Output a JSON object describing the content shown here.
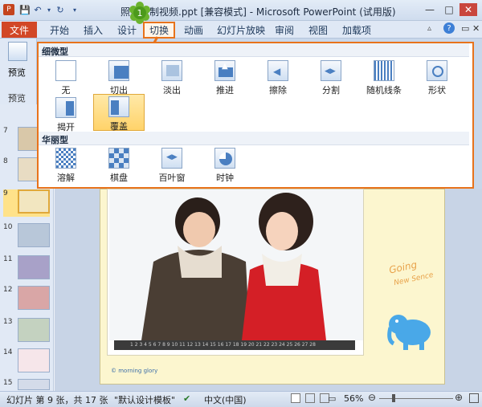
{
  "titlebar": {
    "title": "照片转制视频.ppt [兼容模式] - Microsoft PowerPoint (试用版)"
  },
  "tabs": {
    "file": "文件",
    "items": [
      "开始",
      "插入",
      "设计",
      "切换",
      "动画",
      "幻灯片放映",
      "审阅",
      "视图",
      "加载项"
    ]
  },
  "badge": "1",
  "left": {
    "preview": "预览",
    "preview_group": "预览"
  },
  "gallery": {
    "section1": "细微型",
    "section2": "华丽型",
    "subtle": [
      "无",
      "切出",
      "淡出",
      "推进",
      "擦除",
      "分割",
      "随机线条",
      "形状",
      "揭开",
      "覆盖"
    ],
    "exciting": [
      "溶解",
      "棋盘",
      "百叶窗",
      "时钟"
    ]
  },
  "thumbnails": [
    "7",
    "8",
    "9",
    "10",
    "11",
    "12",
    "13",
    "14",
    "15"
  ],
  "slide": {
    "caption": "© morning glory",
    "deco_text1": "Going",
    "deco_text2": "New Sence",
    "frame_nums": "1 2 3 4 5 6 7 8 9 10 11 12 13 14 15 16 17 18 19 20 21 22 23 24 25 26 27 28"
  },
  "status": {
    "slide_info": "幻灯片 第 9 张，共 17 张",
    "theme": "\"默认设计模板\"",
    "lang": "中文(中国)",
    "zoom": "56%"
  },
  "colors": {
    "accent": "#e8731b",
    "file_tab": "#d24726"
  }
}
